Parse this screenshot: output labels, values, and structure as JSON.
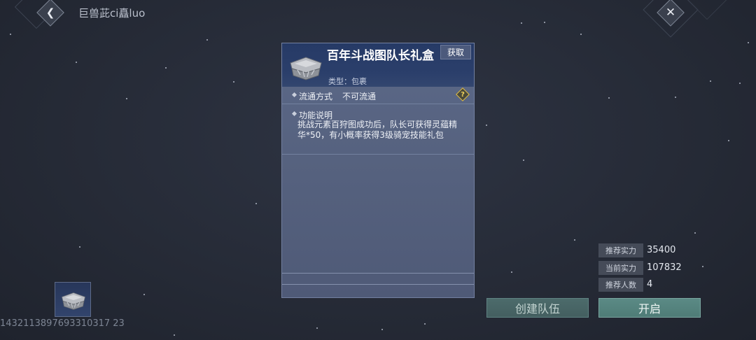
{
  "header": {
    "title": "巨兽茈ci矗luo",
    "back_icon": "chevron-left-icon",
    "close_icon": "close-icon"
  },
  "popup": {
    "item_name": "百年斗战图队长礼盒",
    "obtain_label": "获取",
    "type_label": "类型：包裹",
    "circulation_label": "流通方式",
    "circulation_value": "不可流通",
    "help_symbol": "?",
    "function_title": "功能说明",
    "function_desc": "挑战元素百狩图成功后，队长可获得灵蕴精华*50，有小概率获得3级骑宠技能礼包"
  },
  "slot": {
    "id_text": "1432113897693310317 23"
  },
  "stats": [
    {
      "label": "推荐实力",
      "value": "35400"
    },
    {
      "label": "当前实力",
      "value": "107832"
    },
    {
      "label": "推荐人数",
      "value": "4"
    }
  ],
  "buttons": {
    "create_team": "创建队伍",
    "start": "开启"
  },
  "colors": {
    "background": "#262b37",
    "popup_header": "#263a66",
    "button_teal": "#5b8a85",
    "help_yellow": "#e6c24a"
  }
}
